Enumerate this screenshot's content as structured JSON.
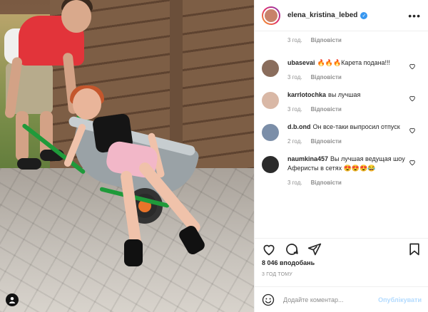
{
  "post": {
    "author": "elena_kristina_lebed",
    "caption_time": "3 год.",
    "reply_label": "Відповісти",
    "likes": "8 046 вподобань",
    "time_ago": "3 ГОД ТОМУ"
  },
  "comments": [
    {
      "user": "ubasevai",
      "text": "🔥🔥🔥Карета подана!!!",
      "time": "3 год.",
      "reply": "Відповісти",
      "avatar_color": "#8a6d5c"
    },
    {
      "user": "karrlotochka",
      "text": "вы лучшая",
      "time": "3 год.",
      "reply": "Відповісти",
      "avatar_color": "#d9b8a6"
    },
    {
      "user": "d.b.ond",
      "text": "Он все-таки выпросил отпуск",
      "time": "2 год.",
      "reply": "Відповісти",
      "avatar_color": "#7b8ea8"
    },
    {
      "user": "naumkina457",
      "text": "Вы лучшая ведущая шоу Аферисты в сетях 😍😍😍😂",
      "time": "3 год.",
      "reply": "Відповісти",
      "avatar_color": "#2b2b2b"
    }
  ],
  "comment_box": {
    "placeholder": "Додайте коментар...",
    "publish_label": "Опублікувати"
  },
  "icons": {
    "more": "more-icon",
    "verified": "verified-badge-icon",
    "like": "heart-icon",
    "comment": "comment-icon",
    "share": "share-icon",
    "save": "bookmark-icon",
    "emoji": "emoji-icon",
    "tagged_user": "user-tag-icon"
  },
  "colors": {
    "accent": "#3897f0",
    "publish_disabled": "#b3dbff",
    "muted": "#8e8e8e"
  }
}
